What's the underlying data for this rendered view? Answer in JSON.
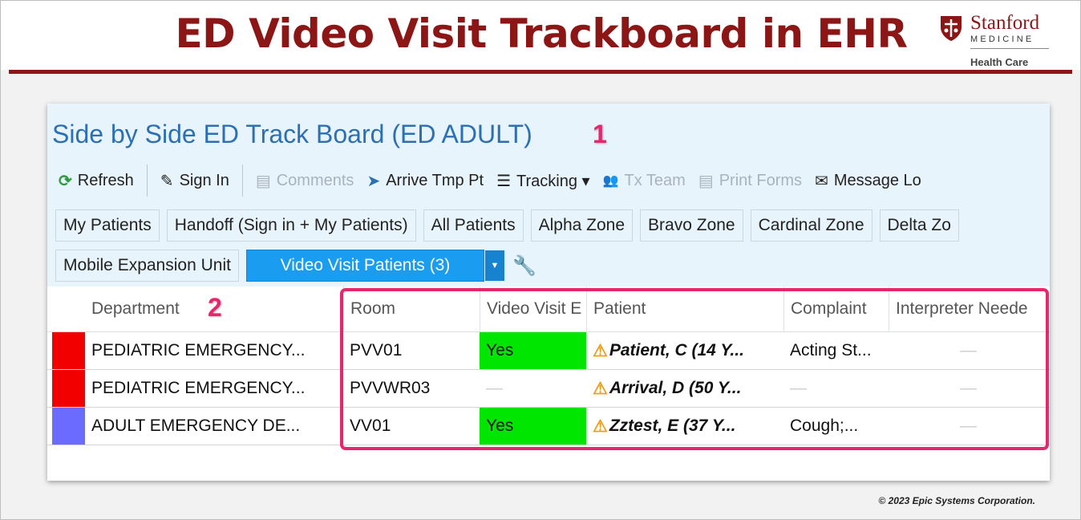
{
  "slide": {
    "title": "ED Video Visit Trackboard in EHR",
    "logo": {
      "word": "Stanford",
      "sub": "MEDICINE",
      "tag": "Health Care"
    },
    "copyright": "© 2023 Epic Systems Corporation.",
    "callouts": [
      "1",
      "2"
    ],
    "colors": {
      "brand": "#8c1515",
      "callout": "#e8266b",
      "active_tab": "#1a9cf0"
    }
  },
  "board": {
    "title": "Side by Side ED Track Board (ED ADULT)",
    "toolbar": [
      {
        "label": "Refresh",
        "icon": "refresh-icon",
        "glyph": "⟳",
        "enabled": true
      },
      {
        "label": "Sign In",
        "icon": "pencil-icon",
        "glyph": "✎",
        "enabled": true
      },
      {
        "label": "Comments",
        "icon": "comments-icon",
        "glyph": "▤",
        "enabled": false
      },
      {
        "label": "Arrive Tmp Pt",
        "icon": "arrive-icon",
        "glyph": "➤",
        "enabled": true
      },
      {
        "label": "Tracking ▾",
        "icon": "list-icon",
        "glyph": "☰",
        "enabled": true
      },
      {
        "label": "Tx Team",
        "icon": "team-icon",
        "glyph": "👥",
        "enabled": false
      },
      {
        "label": "Print Forms",
        "icon": "print-icon",
        "glyph": "▤",
        "enabled": false
      },
      {
        "label": "Message Lo",
        "icon": "mail-icon",
        "glyph": "✉",
        "enabled": true
      }
    ],
    "tabs_row1": [
      "My Patients",
      "Handoff (Sign in + My Patients)",
      "All Patients",
      "Alpha Zone",
      "Bravo Zone",
      "Cardinal Zone",
      "Delta Zo"
    ],
    "tab_mobile": "Mobile Expansion Unit",
    "tab_active": "Video Visit Patients (3)",
    "columns": [
      "Department",
      "Room",
      "Video Visit E",
      "Patient",
      "Complaint",
      "Interpreter Neede"
    ],
    "rows": [
      {
        "flag": "#f20000",
        "department": "PEDIATRIC EMERGENCY...",
        "room": "PVV01",
        "video": "Yes",
        "patient": "Patient, C (14 Y...",
        "complaint": "Acting St...",
        "interpreter": "—"
      },
      {
        "flag": "#f20000",
        "department": "PEDIATRIC EMERGENCY...",
        "room": "PVVWR03",
        "video": "—",
        "patient": "Arrival, D (50 Y...",
        "complaint": "—",
        "interpreter": "—"
      },
      {
        "flag": "#6b6bff",
        "department": "ADULT EMERGENCY DE...",
        "room": "VV01",
        "video": "Yes",
        "patient": "Zztest, E (37 Y...",
        "complaint": "Cough;...",
        "interpreter": "—"
      }
    ]
  }
}
